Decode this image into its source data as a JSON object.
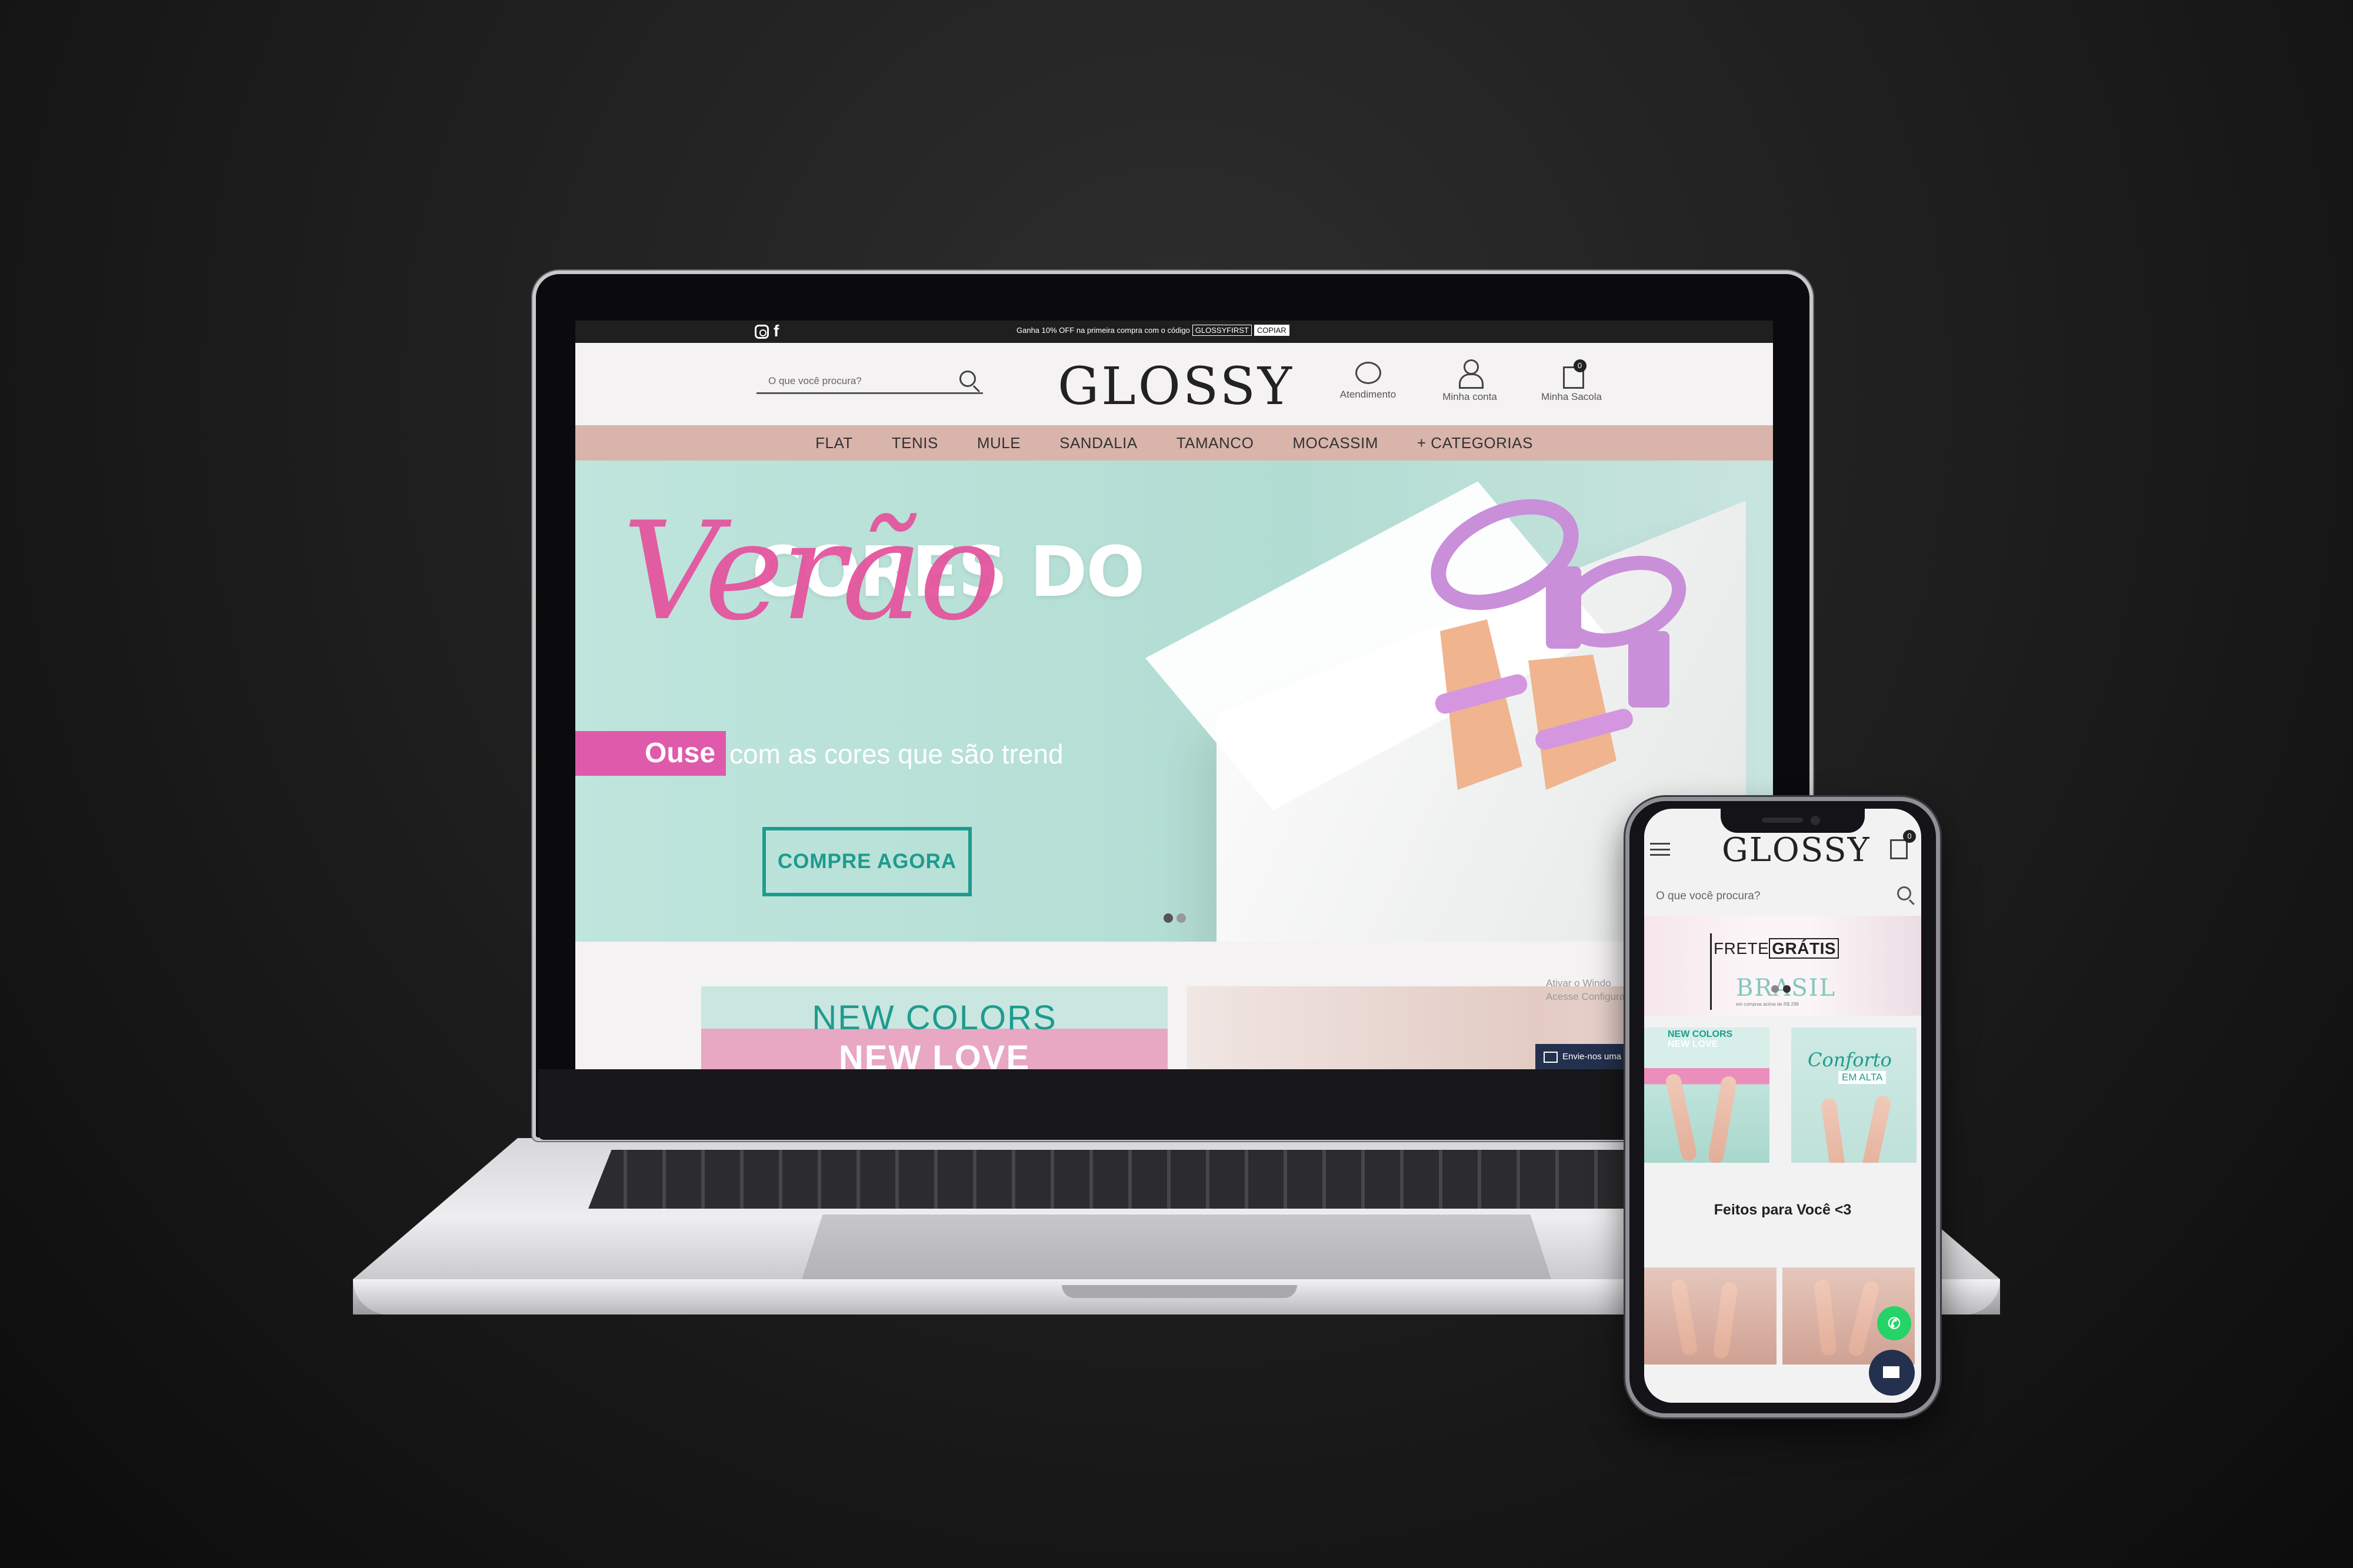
{
  "desktop": {
    "topbar": {
      "social": [
        "instagram-icon",
        "facebook-icon"
      ],
      "promo_text": "Ganha 10% OFF na primeira compra com o código",
      "promo_code": "GLOSSYFIRST",
      "copy_label": "COPIAR"
    },
    "header": {
      "search_placeholder": "O que você procura?",
      "logo": "GLOSSY",
      "actions": [
        {
          "label": "Atendimento",
          "icon": "chat-icon"
        },
        {
          "label": "Minha conta",
          "icon": "user-icon"
        },
        {
          "label": "Minha Sacola",
          "icon": "bag-icon",
          "count": "0"
        }
      ]
    },
    "nav": [
      "FLAT",
      "TENIS",
      "MULE",
      "SANDALIA",
      "TAMANCO",
      "MOCASSIM",
      "+ CATEGORIAS"
    ],
    "hero": {
      "script": "Verão",
      "title": "CORES DO",
      "highlight": "Ouse",
      "tagline": "com as cores que são trend",
      "cta": "COMPRE AGORA",
      "colors": {
        "background": "#bfe5dd",
        "accent": "#e05aab",
        "cta": "#1e9b8f"
      }
    },
    "below": {
      "banner_line1": "NEW COLORS",
      "banner_line2": "NEW LOVE",
      "watermark_line1": "Ativar o Windo",
      "watermark_line2": "Acesse Configuraç",
      "chat_label": "Envie-nos uma"
    }
  },
  "mobile": {
    "logo": "GLOSSY",
    "bag_count": "0",
    "search_placeholder": "O que você procura?",
    "frete": {
      "title_light": "FRETE",
      "title_bold": "GRÁTIS",
      "location": "BRASIL",
      "fine_print": "em compras acima de R$ 299"
    },
    "tiles": [
      {
        "line1": "NEW COLORS",
        "line2": "NEW LOVE"
      },
      {
        "script": "Conforto",
        "label": "EM ALTA"
      }
    ],
    "section_title": "Feitos para Você <3"
  }
}
